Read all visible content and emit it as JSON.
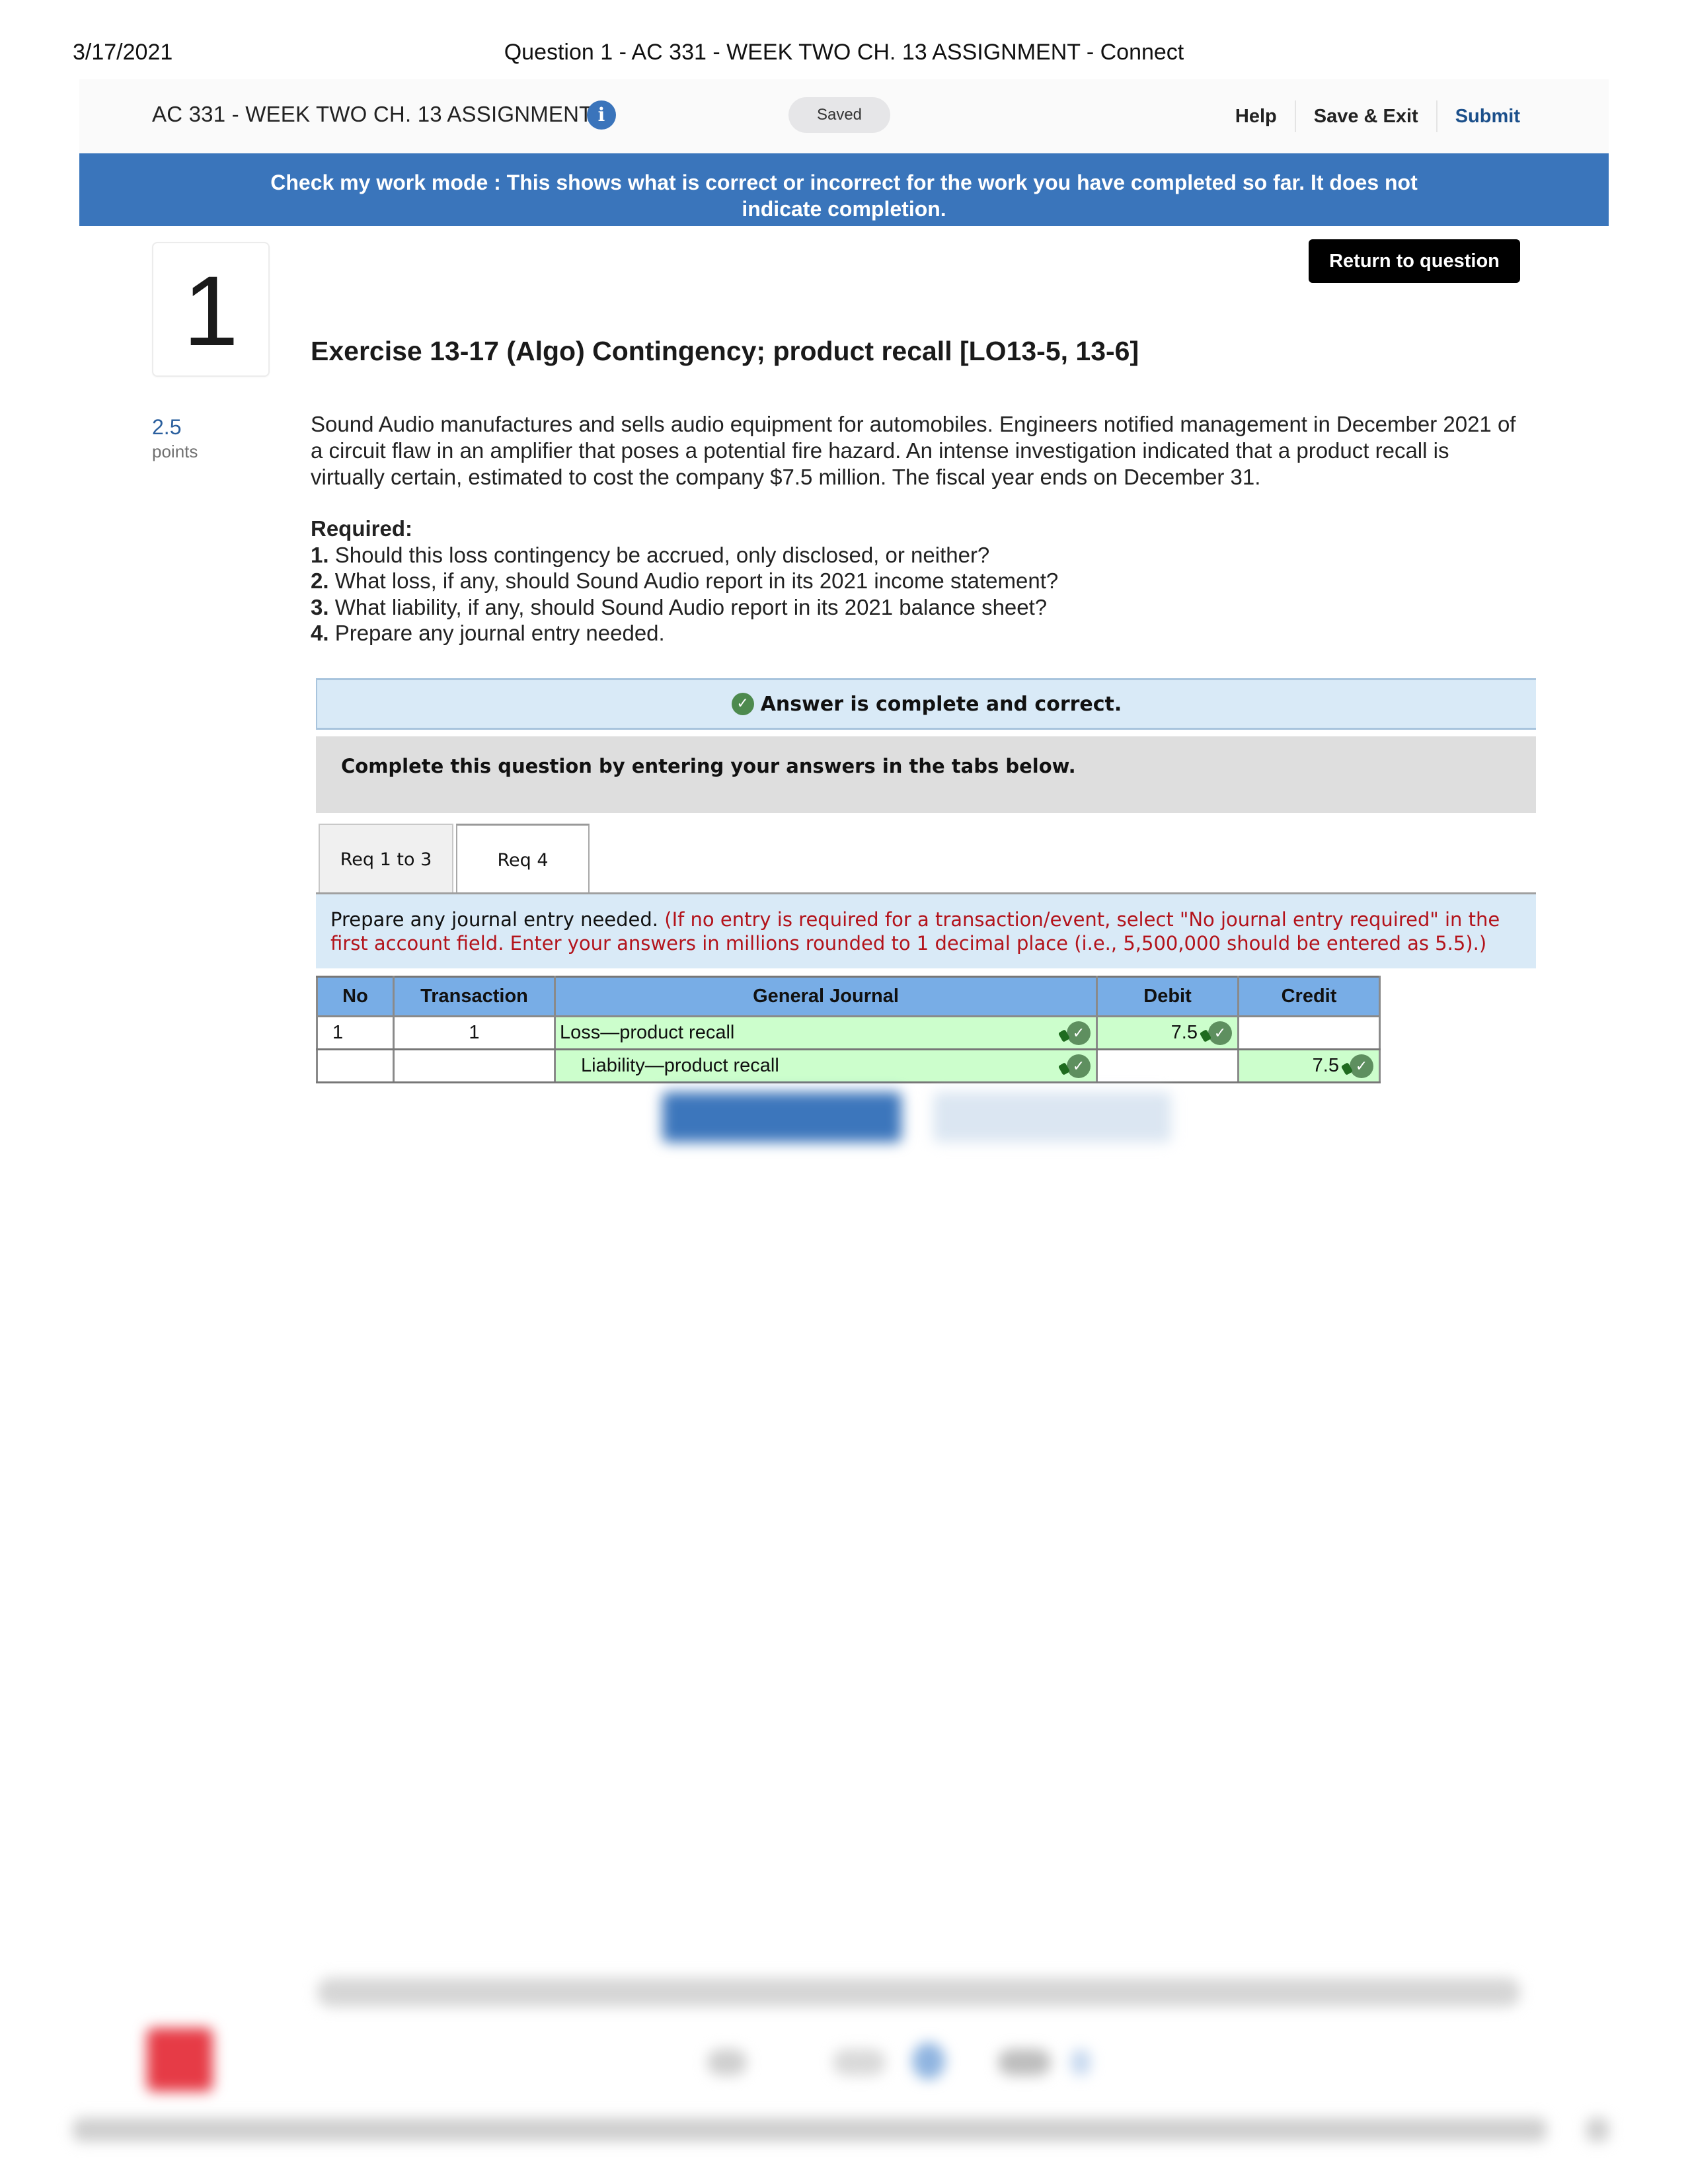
{
  "print_header": {
    "date": "3/17/2021",
    "title": "Question 1 - AC 331 - WEEK TWO CH. 13 ASSIGNMENT - Connect"
  },
  "header": {
    "assignment_title": "AC 331 - WEEK TWO CH. 13 ASSIGNMENT",
    "info_icon": "i",
    "save_status": "Saved",
    "nav": {
      "help": "Help",
      "save_exit": "Save & Exit",
      "submit": "Submit"
    }
  },
  "banner": {
    "text": "Check my work mode : This shows what is correct or incorrect for the work you have completed so far. It does not indicate completion."
  },
  "question": {
    "number": "1",
    "return_button": "Return to question",
    "title": "Exercise 13-17 (Algo) Contingency; product recall [LO13-5, 13-6]",
    "points_value": "2.5",
    "points_label": "points",
    "prompt": "Sound Audio manufactures and sells audio equipment for automobiles. Engineers notified management in December 2021 of a circuit flaw in an amplifier that poses a potential fire hazard. An intense investigation indicated that a product recall is virtually certain, estimated to cost the company $7.5 million. The fiscal year ends on December 31.",
    "required_label": "Required:",
    "requirements": [
      {
        "num": "1.",
        "text": " Should this loss contingency be accrued, only disclosed, or neither?"
      },
      {
        "num": "2.",
        "text": " What loss, if any, should Sound Audio report in its 2021 income statement?"
      },
      {
        "num": "3.",
        "text": " What liability, if any, should Sound Audio report in its 2021 balance sheet?"
      },
      {
        "num": "4.",
        "text": " Prepare any journal entry needed."
      }
    ]
  },
  "answer": {
    "status_icon": "check-circle",
    "status_text": "Answer is complete and correct.",
    "instructions": "Complete this question by entering your answers in the tabs below.",
    "tabs": [
      {
        "label": "Req 1 to 3",
        "active": false
      },
      {
        "label": "Req 4",
        "active": true
      }
    ],
    "req_instruction": "Prepare any journal entry needed.",
    "req_note": "(If no entry is required for a transaction/event, select \"No journal entry required\" in the first account field. Enter your answers in millions rounded to 1 decimal place (i.e., 5,500,000 should be entered as 5.5).)"
  },
  "journal": {
    "headers": [
      "No",
      "Transaction",
      "General Journal",
      "Debit",
      "Credit"
    ],
    "rows": [
      {
        "no": "1",
        "transaction": "1",
        "account": "Loss—product recall",
        "debit": "7.5",
        "credit": "",
        "account_correct": true,
        "debit_correct": true,
        "credit_correct": null
      },
      {
        "no": "",
        "transaction": "",
        "account": "Liability—product recall",
        "debit": "",
        "credit": "7.5",
        "account_correct": true,
        "debit_correct": null,
        "credit_correct": true
      }
    ]
  },
  "colors": {
    "banner_blue": "#3a75bb",
    "submit_blue": "#1b4f8a",
    "header_table_blue": "#78ade6",
    "correct_green_fill": "#ccfecc",
    "check_green": "#5e8f5f",
    "note_red": "#b3131b"
  }
}
